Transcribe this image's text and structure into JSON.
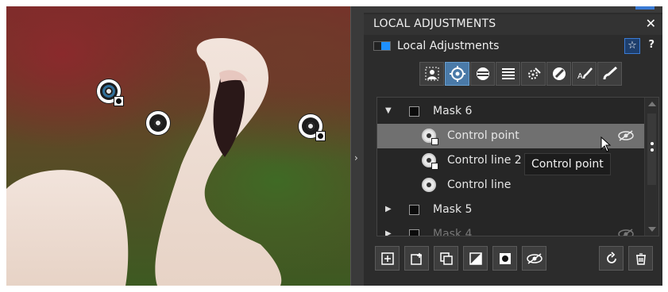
{
  "panel": {
    "title": "LOCAL ADJUSTMENTS",
    "close_label": "✕",
    "section_label": "Local Adjustments",
    "help_label": "?",
    "favorite_icon": "star-icon"
  },
  "toolbar": {
    "tools": [
      {
        "icon": "portrait-mask-icon",
        "active": false
      },
      {
        "icon": "control-point-icon",
        "active": true
      },
      {
        "icon": "control-line-icon",
        "active": false
      },
      {
        "icon": "gradient-icon",
        "active": false
      },
      {
        "icon": "auto-mask-icon",
        "active": false
      },
      {
        "icon": "color-picker-icon",
        "active": false
      },
      {
        "icon": "luminosity-brush-icon",
        "active": false,
        "text": "A"
      },
      {
        "icon": "brush-icon",
        "active": false
      }
    ]
  },
  "layers": [
    {
      "type": "mask",
      "label": "Mask 6",
      "expanded": true
    },
    {
      "type": "control",
      "label": "Control point",
      "selected": true
    },
    {
      "type": "control",
      "label": "Control line 2"
    },
    {
      "type": "control",
      "label": "Control line"
    },
    {
      "type": "mask",
      "label": "Mask 5",
      "expanded": false
    },
    {
      "type": "mask",
      "label": "Mask 4",
      "expanded": false,
      "faded": true
    }
  ],
  "tooltip": {
    "text": "Control point"
  },
  "bottom_toolbar": {
    "left": [
      "add-mask-icon",
      "add-from-icon",
      "duplicate-icon",
      "invert-icon",
      "mask-view-icon",
      "visibility-icon"
    ],
    "right": [
      "reset-icon",
      "delete-icon"
    ]
  },
  "colors": {
    "accent": "#1e90ff",
    "selected_row": "#707070",
    "panel_bg": "#2c2c2c"
  }
}
